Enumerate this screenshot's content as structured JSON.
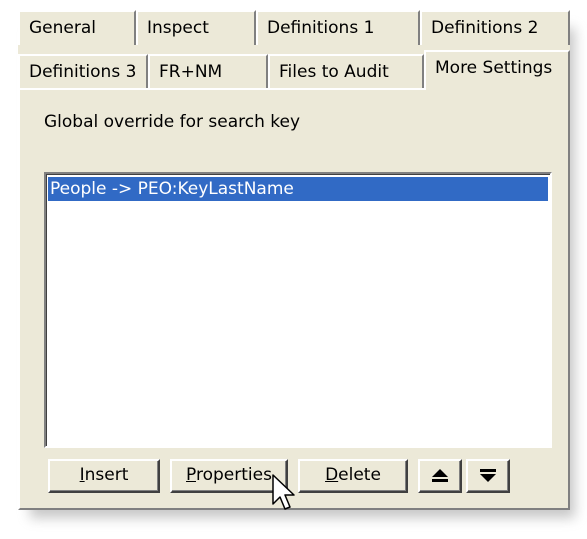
{
  "tabs_row1": [
    {
      "label": "General"
    },
    {
      "label": "Inspect"
    },
    {
      "label": "Definitions 1"
    },
    {
      "label": "Definitions 2"
    }
  ],
  "tabs_row2": [
    {
      "label": "Definitions 3"
    },
    {
      "label": "FR+NM"
    },
    {
      "label": "Files to Audit"
    },
    {
      "label": "More Settings",
      "active": true
    }
  ],
  "panel": {
    "label": "Global override for search key",
    "list_items": [
      {
        "text": "People -> PEO:KeyLastName",
        "selected": true
      }
    ]
  },
  "buttons": {
    "insert": {
      "first": "I",
      "rest": "nsert"
    },
    "properties": {
      "first": "P",
      "rest": "roperties"
    },
    "delete": {
      "first": "D",
      "rest": "elete"
    },
    "move_up": "move-up-icon",
    "move_down": "move-down-icon"
  },
  "colors": {
    "face": "#ece9d8",
    "selection": "#316ac5"
  }
}
